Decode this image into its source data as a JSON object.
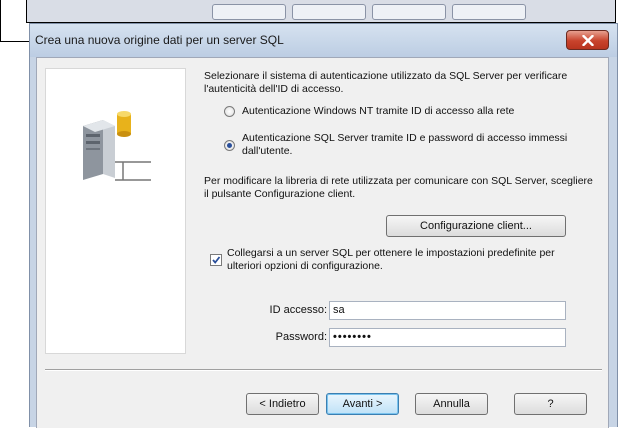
{
  "dialog": {
    "title": "Crea una nuova origine dati per un server SQL"
  },
  "intro_text": "Selezionare il sistema di autenticazione utilizzato da SQL Server per verificare l'autenticità dell'ID di accesso.",
  "auth_options": [
    {
      "label": "Autenticazione Windows NT tramite ID di accesso alla rete",
      "selected": false
    },
    {
      "label": "Autenticazione SQL Server tramite ID e password di accesso immessi dall'utente.",
      "selected": true
    }
  ],
  "network_text": "Per modificare la libreria di rete utilizzata per comunicare con SQL Server, scegliere il pulsante Configurazione client.",
  "client_config_button": "Configurazione client...",
  "connect_checkbox": {
    "label": "Collegarsi a un server SQL per ottenere le impostazioni predefinite per ulteriori opzioni di configurazione.",
    "checked": true
  },
  "login": {
    "id_label": "ID accesso:",
    "id_value": "sa",
    "password_label": "Password:",
    "password_value": "••••••••"
  },
  "buttons": {
    "back": "< Indietro",
    "next": "Avanti >",
    "cancel": "Annulla",
    "help": "?"
  },
  "colors": {
    "accent": "#3c7fb1",
    "close_button": "#c8432c"
  },
  "icons": {
    "close": "close-icon",
    "server": "database-server-icon"
  }
}
